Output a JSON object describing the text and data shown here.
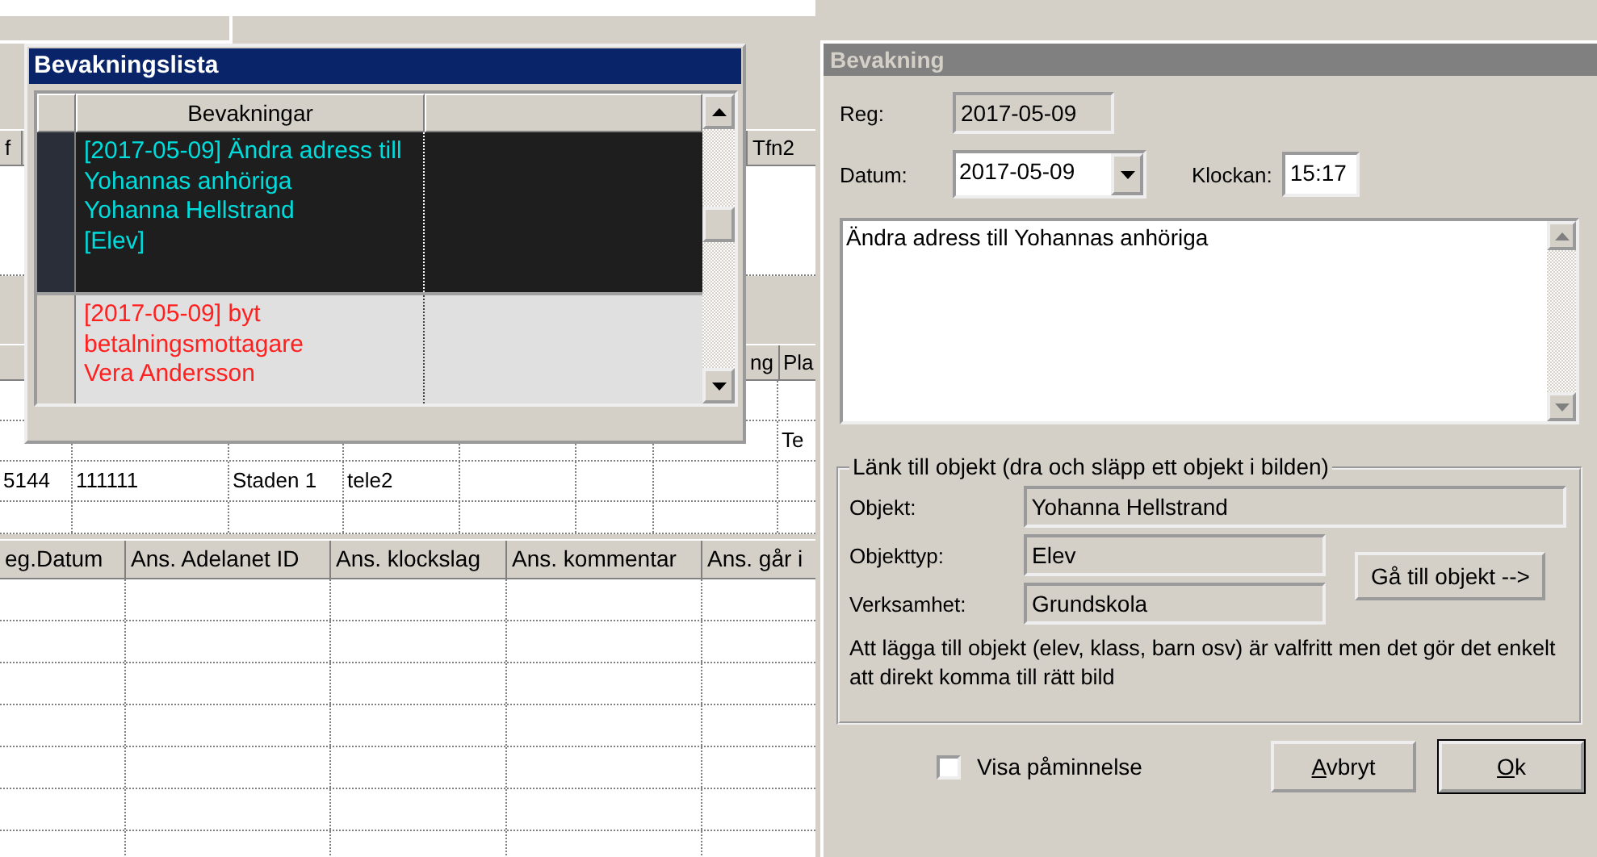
{
  "upper_grid": {
    "headers": {
      "column_1": "f",
      "column_3": "Tfn2"
    }
  },
  "middle_grid": {
    "headers": {
      "column_7": "ng",
      "column_8": "Pla"
    },
    "rows": [
      {
        "column_8": "Te"
      },
      {
        "column_1": "5144",
        "column_2": "111111",
        "column_3": "Staden 1",
        "column_4": "tele2"
      }
    ]
  },
  "lower_grid": {
    "headers": [
      "eg.Datum",
      "Ans. Adelanet ID",
      "Ans. klockslag",
      "Ans. kommentar",
      "Ans. går i"
    ]
  },
  "watch_list_window": {
    "title": "Bevakningslista",
    "column": "Bevakningar",
    "items": [
      {
        "lines": [
          "[2017-05-09] Ändra adress till",
          "Yohannas anhöriga",
          "Yohanna Hellstrand",
          "[Elev]"
        ],
        "selected": true
      },
      {
        "lines": [
          "[2017-05-09] byt",
          "betalningsmottagare",
          "Vera Andersson"
        ],
        "selected": false
      }
    ]
  },
  "watch_dialog": {
    "title": "Bevakning",
    "reg_label": "Reg:",
    "reg_value": "2017-05-09",
    "date_label": "Datum:",
    "date_value": "2017-05-09",
    "time_label": "Klockan:",
    "time_value": "15:17",
    "note": "Ändra adress till Yohannas anhöriga",
    "link_group": {
      "legend": "Länk till objekt (dra och släpp ett objekt i bilden)",
      "object_label": "Objekt:",
      "object_value": "Yohanna Hellstrand",
      "type_label": "Objekttyp:",
      "type_value": "Elev",
      "unit_label": "Verksamhet:",
      "unit_value": "Grundskola",
      "goto_button": "Gå till objekt -->",
      "hint": "Att lägga till objekt (elev, klass, barn osv) är valfritt men det gör det enkelt att direkt komma till rätt bild"
    },
    "reminder": {
      "label": "Visa påminnelse",
      "checked": false
    },
    "buttons": [
      {
        "label": "Avbryt",
        "default": false
      },
      {
        "label": "Ok",
        "default": true
      }
    ]
  }
}
